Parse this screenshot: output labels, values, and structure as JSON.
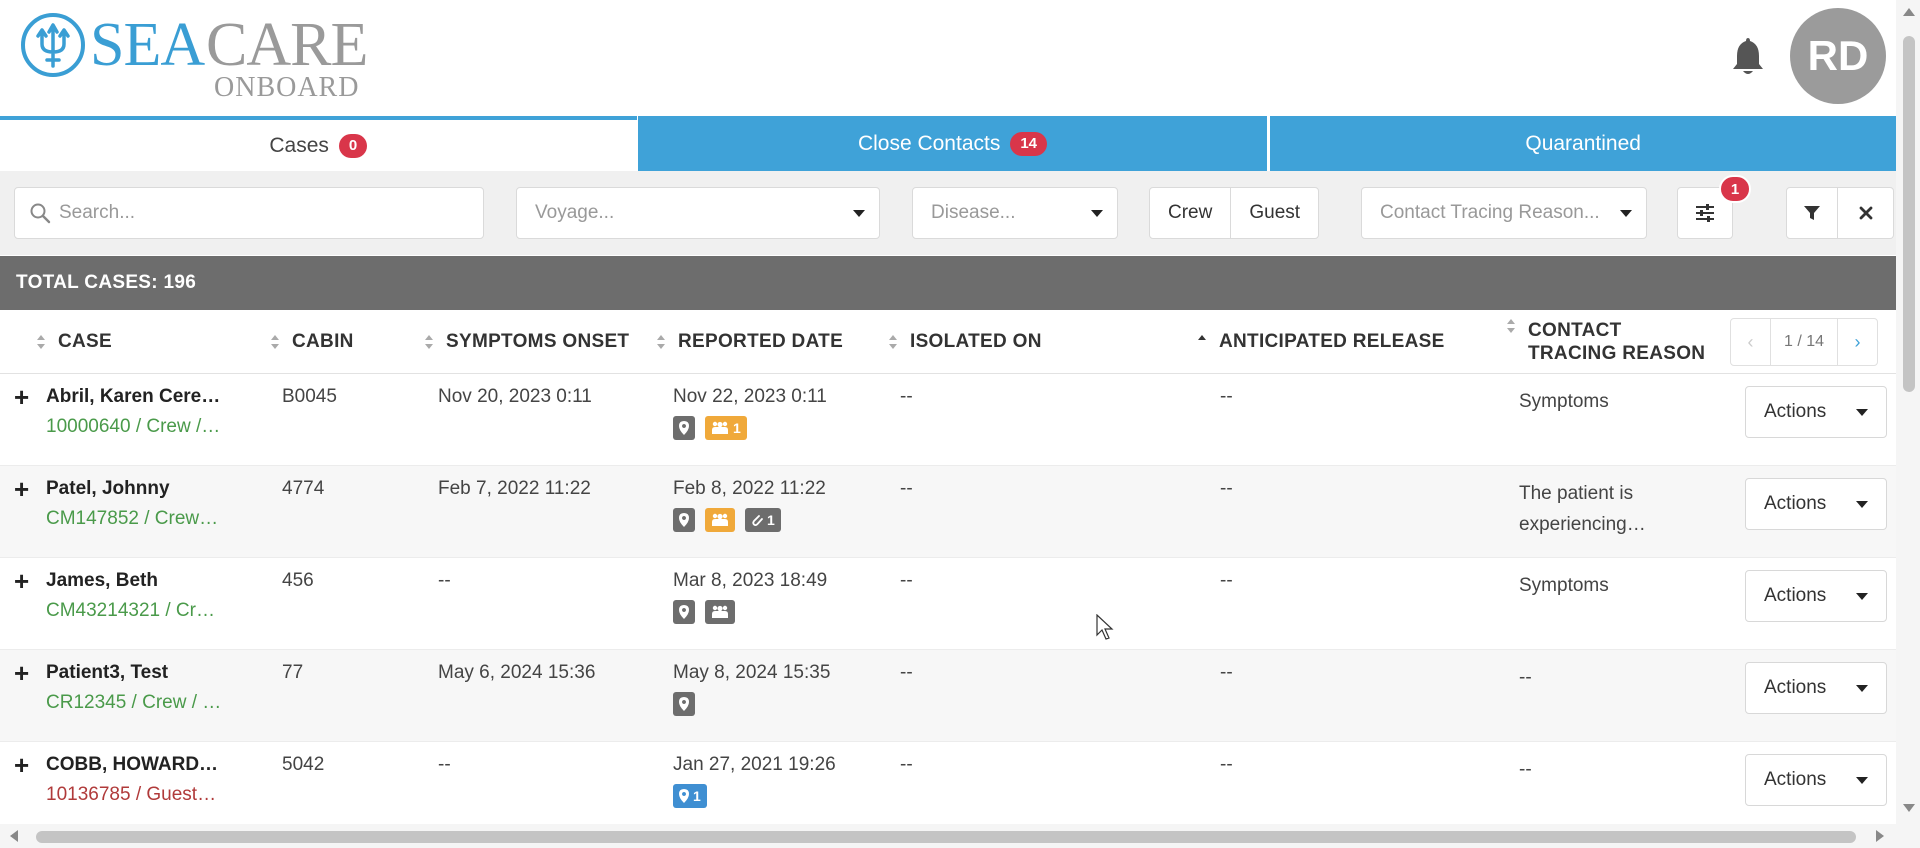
{
  "brand": {
    "sea": "SEA",
    "care": "CARE",
    "onboard": "ONBOARD",
    "primary_color": "#3a9ed4",
    "secondary_color": "#9a9a9a"
  },
  "header": {
    "avatar_initials": "RD",
    "bell_icon": "bell-icon"
  },
  "tabs": [
    {
      "label": "Cases",
      "badge": "0",
      "active": true
    },
    {
      "label": "Close Contacts",
      "badge": "14",
      "active": false
    },
    {
      "label": "Quarantined",
      "badge": "",
      "active": false
    }
  ],
  "filters": {
    "search_placeholder": "Search...",
    "voyage_placeholder": "Voyage...",
    "disease_placeholder": "Disease...",
    "segment": [
      "Crew",
      "Guest"
    ],
    "reason_placeholder": "Contact Tracing Reason...",
    "settings_badge": "1"
  },
  "summary": {
    "total_label": "TOTAL CASES: 196"
  },
  "columns": {
    "case": "CASE",
    "cabin": "CABIN",
    "symptoms_onset": "SYMPTOMS ONSET",
    "reported_date": "REPORTED DATE",
    "isolated_on": "ISOLATED ON",
    "anticipated_release": "ANTICIPATED RELEASE",
    "contact_tracing_line1": "CONTACT",
    "contact_tracing_line2": "TRACING REASON"
  },
  "pager": {
    "text": "1 / 14",
    "prev": "‹",
    "next": "›"
  },
  "actions_label": "Actions",
  "rows": [
    {
      "name": "Abril, Karen Cere…",
      "sub": "10000640 / Crew /…",
      "sub_type": "crew",
      "cabin": "B0045",
      "onset": "Nov 20, 2023 0:11",
      "reported": "Nov 22, 2023 0:11",
      "isolated": "--",
      "release": "--",
      "reason": "Symptoms",
      "tags": [
        {
          "color": "gray",
          "icon": "location-icon",
          "count": ""
        },
        {
          "color": "orange",
          "icon": "group-icon",
          "count": "1"
        }
      ]
    },
    {
      "name": "Patel, Johnny",
      "sub": "CM147852 / Crew…",
      "sub_type": "crew",
      "cabin": "4774",
      "onset": "Feb 7, 2022 11:22",
      "reported": "Feb 8, 2022 11:22",
      "isolated": "--",
      "release": "--",
      "reason": "The patient is experiencing…",
      "tags": [
        {
          "color": "gray",
          "icon": "location-icon",
          "count": ""
        },
        {
          "color": "orange",
          "icon": "group-icon",
          "count": ""
        },
        {
          "color": "gray",
          "icon": "paperclip-icon",
          "count": "1"
        }
      ]
    },
    {
      "name": "James, Beth",
      "sub": "CM43214321 / Cr…",
      "sub_type": "crew",
      "cabin": "456",
      "onset": "--",
      "reported": "Mar 8, 2023 18:49",
      "isolated": "--",
      "release": "--",
      "reason": "Symptoms",
      "tags": [
        {
          "color": "gray",
          "icon": "location-icon",
          "count": ""
        },
        {
          "color": "gray",
          "icon": "group-icon",
          "count": ""
        }
      ]
    },
    {
      "name": "Patient3, Test",
      "sub": "CR12345 / Crew / …",
      "sub_type": "crew",
      "cabin": "77",
      "onset": "May 6, 2024 15:36",
      "reported": "May 8, 2024 15:35",
      "isolated": "--",
      "release": "--",
      "reason": "--",
      "tags": [
        {
          "color": "gray",
          "icon": "location-icon",
          "count": ""
        }
      ]
    },
    {
      "name": "COBB, HOWARD…",
      "sub": "10136785 / Guest…",
      "sub_type": "guest",
      "cabin": "5042",
      "onset": "--",
      "reported": "Jan 27, 2021 19:26",
      "isolated": "--",
      "release": "--",
      "reason": "--",
      "tags": [
        {
          "color": "blue",
          "icon": "location-icon",
          "count": "1"
        }
      ]
    }
  ],
  "colors": {
    "accent": "#3fa2d8",
    "badge": "#d9364a",
    "crew_text": "#4a9a4a",
    "guest_text": "#b03a3a",
    "total_bar": "#6d6d6d"
  }
}
